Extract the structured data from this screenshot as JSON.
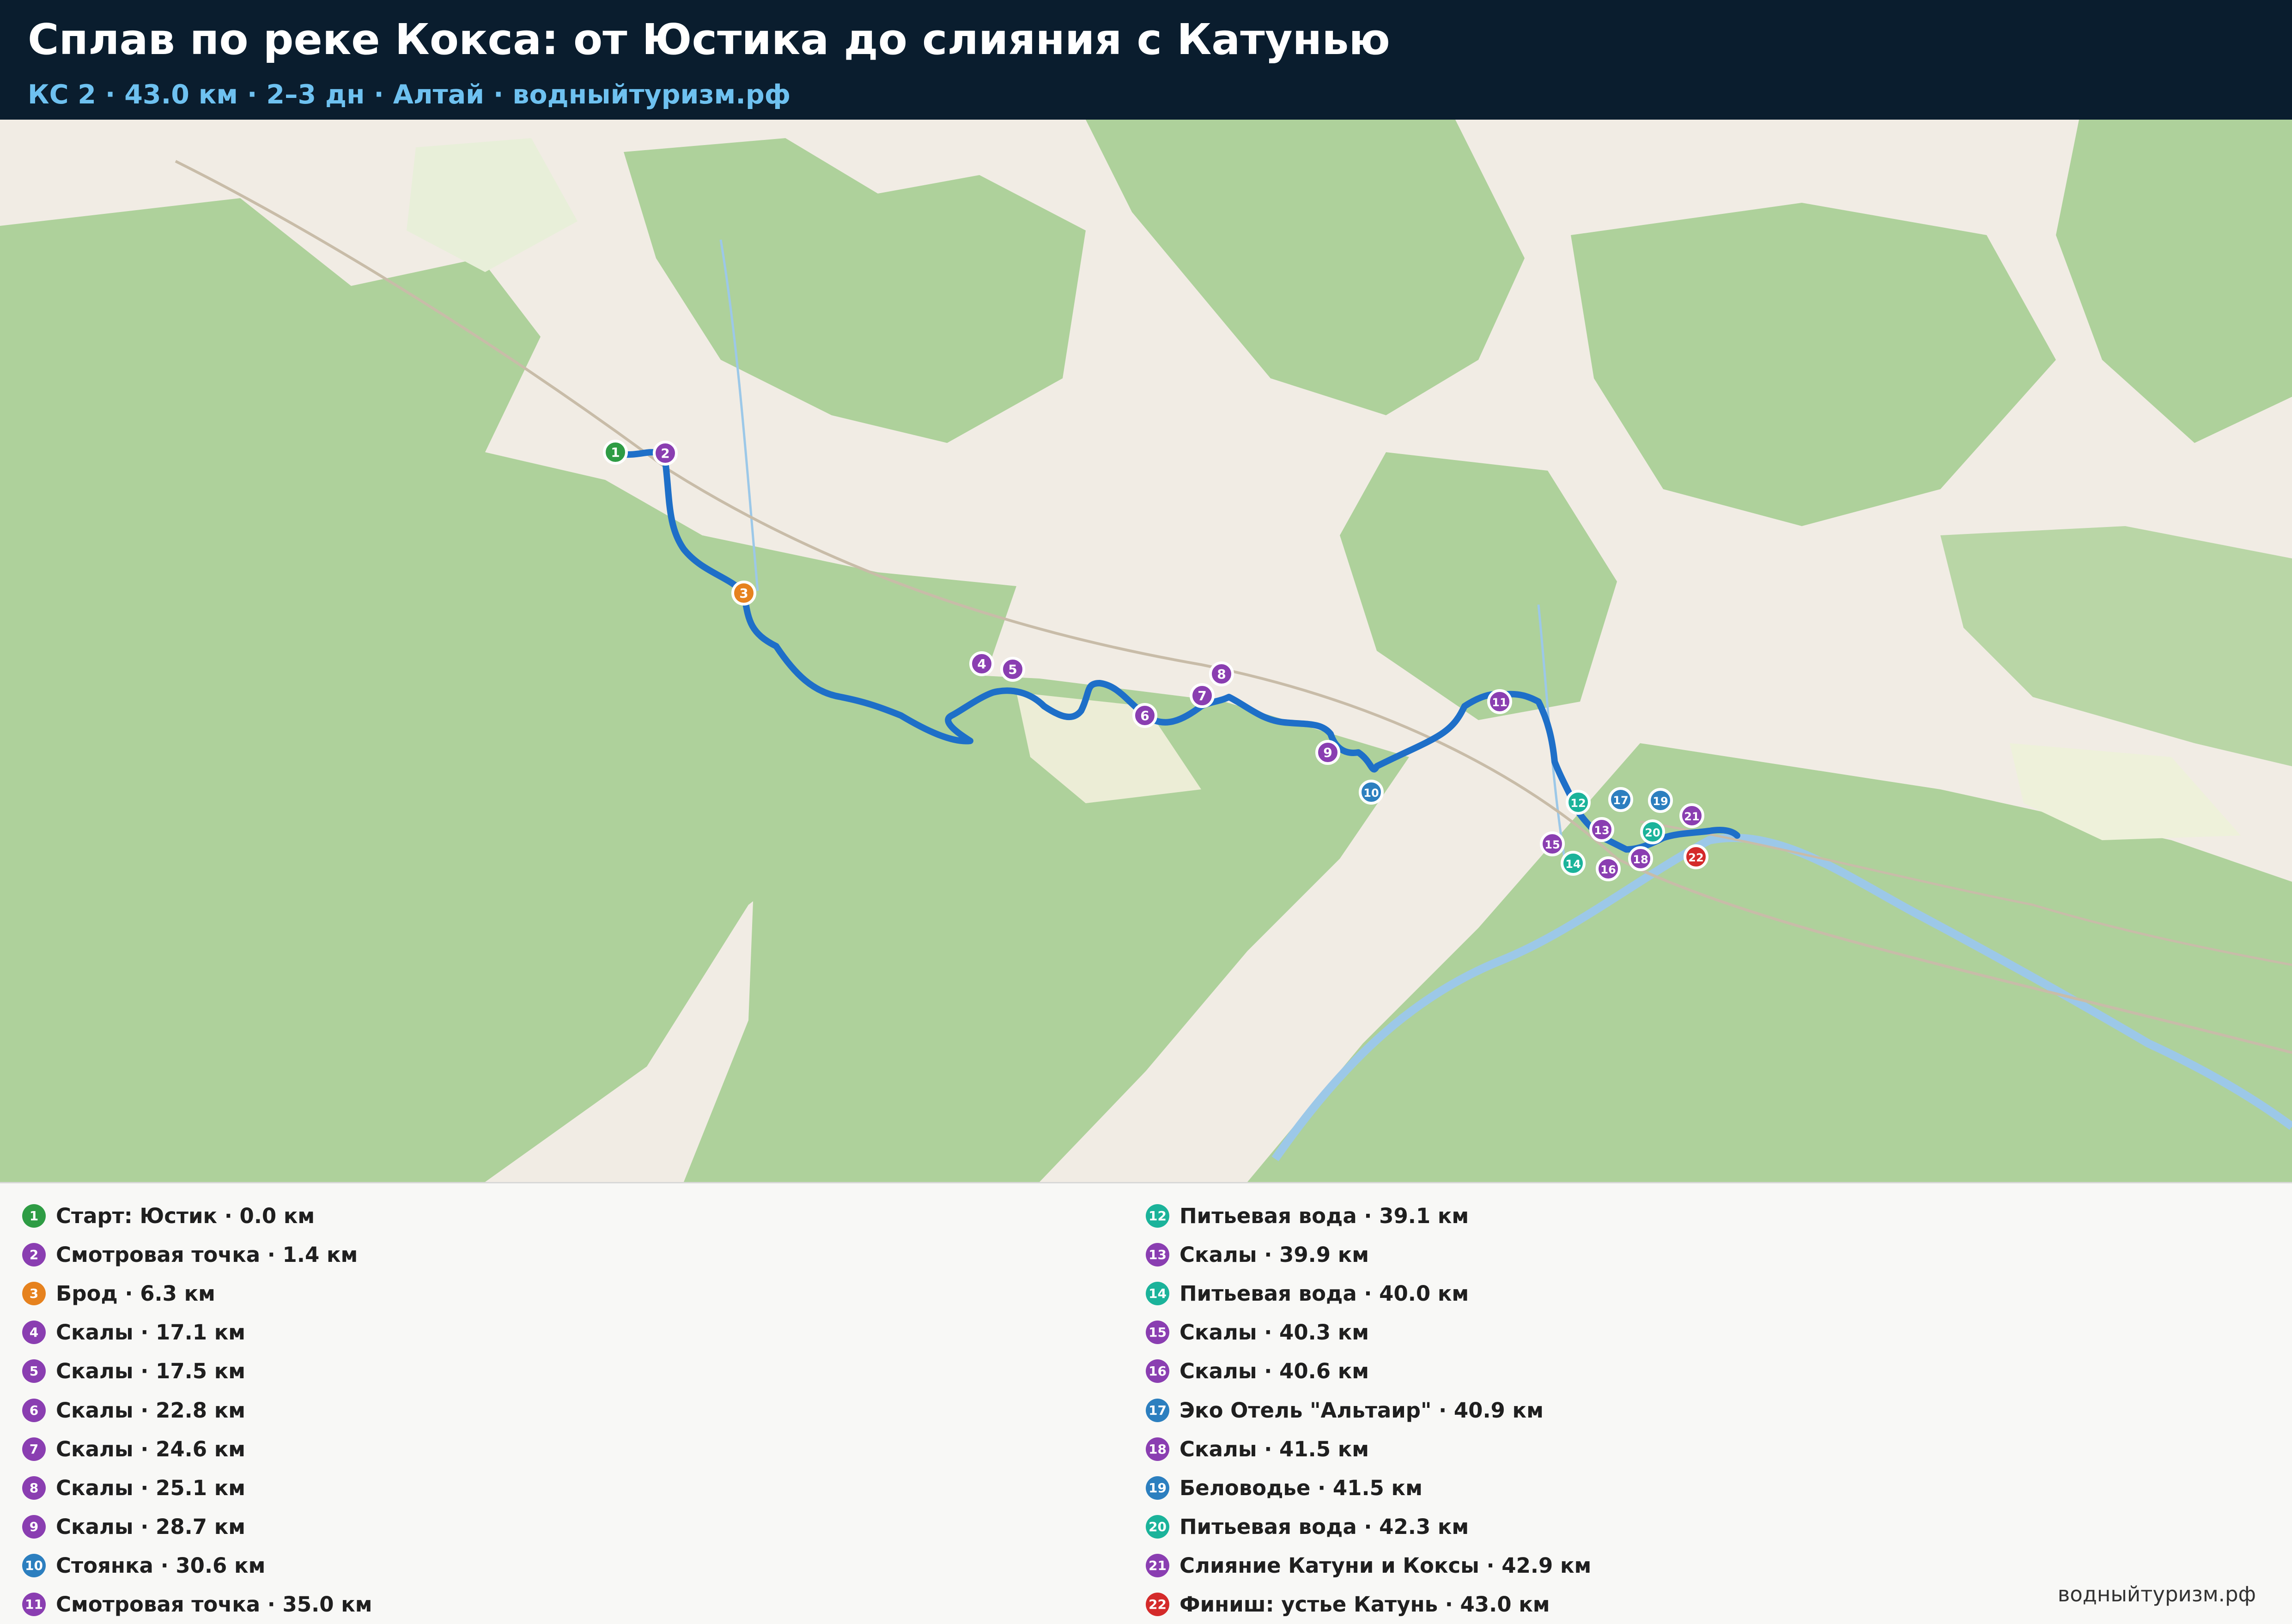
{
  "header": {
    "title": "Сплав по реке Кокса: от Юстика до слияния с Катунью",
    "subtitle": "КС 2  ·  43.0 км  ·  2–3 дн  ·  Алтай  ·  водныйтуризм.рф"
  },
  "colors": {
    "header_bg": "#0a1d2e",
    "subtitle": "#6ec1f0",
    "route": "#1e6fc8",
    "forest": "#aed19b",
    "meadow": "#f1ece4",
    "start": "#2e9c44",
    "viewpoint": "#8a3eb1",
    "ford": "#e6821e",
    "rocks": "#8a3eb1",
    "camp": "#2c7fbf",
    "water": "#1bb39a",
    "finish": "#d42a2a"
  },
  "waypoints": [
    {
      "num": "1",
      "label": "Старт: Юстик · 0.0 км",
      "kind": "start",
      "color": "#2e9c44"
    },
    {
      "num": "2",
      "label": "Смотровая точка · 1.4 км",
      "kind": "viewpoint",
      "color": "#8a3eb1"
    },
    {
      "num": "3",
      "label": "Брод · 6.3 км",
      "kind": "ford",
      "color": "#e6821e"
    },
    {
      "num": "4",
      "label": "Скалы · 17.1 км",
      "kind": "rocks",
      "color": "#8a3eb1"
    },
    {
      "num": "5",
      "label": "Скалы · 17.5 км",
      "kind": "rocks",
      "color": "#8a3eb1"
    },
    {
      "num": "6",
      "label": "Скалы · 22.8 км",
      "kind": "rocks",
      "color": "#8a3eb1"
    },
    {
      "num": "7",
      "label": "Скалы · 24.6 км",
      "kind": "rocks",
      "color": "#8a3eb1"
    },
    {
      "num": "8",
      "label": "Скалы · 25.1 км",
      "kind": "rocks",
      "color": "#8a3eb1"
    },
    {
      "num": "9",
      "label": "Скалы · 28.7 км",
      "kind": "rocks",
      "color": "#8a3eb1"
    },
    {
      "num": "10",
      "label": "Стоянка · 30.6 км",
      "kind": "camp",
      "color": "#2c7fbf"
    },
    {
      "num": "11",
      "label": "Смотровая точка · 35.0 км",
      "kind": "viewpoint",
      "color": "#8a3eb1"
    },
    {
      "num": "12",
      "label": "Питьевая вода · 39.1 км",
      "kind": "water",
      "color": "#1bb39a"
    },
    {
      "num": "13",
      "label": "Скалы · 39.9 км",
      "kind": "rocks",
      "color": "#8a3eb1"
    },
    {
      "num": "14",
      "label": "Питьевая вода · 40.0 км",
      "kind": "water",
      "color": "#1bb39a"
    },
    {
      "num": "15",
      "label": "Скалы · 40.3 км",
      "kind": "rocks",
      "color": "#8a3eb1"
    },
    {
      "num": "16",
      "label": "Скалы · 40.6 км",
      "kind": "rocks",
      "color": "#8a3eb1"
    },
    {
      "num": "17",
      "label": "Эко Отель \"Альтаир\" · 40.9 км",
      "kind": "camp",
      "color": "#2c7fbf"
    },
    {
      "num": "18",
      "label": "Скалы · 41.5 км",
      "kind": "rocks",
      "color": "#8a3eb1"
    },
    {
      "num": "19",
      "label": "Беловодье · 41.5 км",
      "kind": "camp",
      "color": "#2c7fbf"
    },
    {
      "num": "20",
      "label": "Питьевая вода · 42.3 км",
      "kind": "water",
      "color": "#1bb39a"
    },
    {
      "num": "21",
      "label": "Слияние Катуни и Коксы · 42.9 км",
      "kind": "viewpoint",
      "color": "#8a3eb1"
    },
    {
      "num": "22",
      "label": "Финиш: устье Катунь · 43.0 км",
      "kind": "finish",
      "color": "#d42a2a"
    }
  ],
  "footer": {
    "brand": "водныйтуризм.рф"
  }
}
